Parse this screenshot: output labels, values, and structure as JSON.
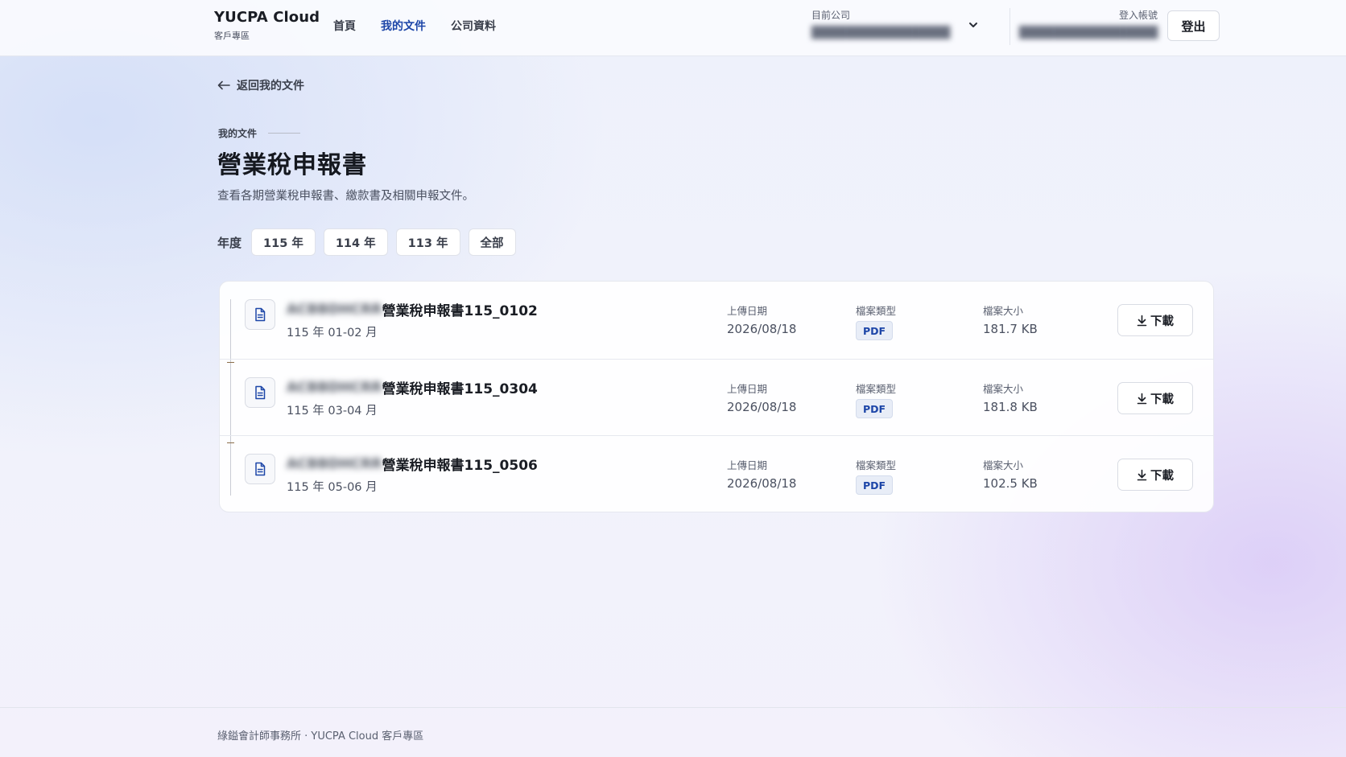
{
  "header": {
    "brand_title": "YUCPA Cloud",
    "brand_subtitle": "客戶專區",
    "nav": [
      {
        "label": "首頁",
        "active": false
      },
      {
        "label": "我的文件",
        "active": true
      },
      {
        "label": "公司資料",
        "active": false
      }
    ],
    "company_label": "目前公司",
    "company_value": "",
    "account_label": "登入帳號",
    "account_value": "",
    "logout_label": "登出"
  },
  "back_link": "返回我的文件",
  "eyebrow": "我的文件",
  "page_title": "營業稅申報書",
  "page_description": "查看各期營業稅申報書、繳款書及相關申報文件。",
  "year_filter": {
    "label": "年度",
    "options": [
      "115 年",
      "114 年",
      "113 年",
      "全部"
    ]
  },
  "documents": [
    {
      "title": "營業稅申報書115_0102",
      "period": "115 年 01-02 月",
      "upload_label": "上傳日期",
      "upload_date": "2026/08/18",
      "type_label": "檔案類型",
      "type": "PDF",
      "size_label": "檔案大小",
      "size": "181.7 KB",
      "download_label": "下載"
    },
    {
      "title": "營業稅申報書115_0304",
      "period": "115 年 03-04 月",
      "upload_label": "上傳日期",
      "upload_date": "2026/08/18",
      "type_label": "檔案類型",
      "type": "PDF",
      "size_label": "檔案大小",
      "size": "181.8 KB",
      "download_label": "下載"
    },
    {
      "title": "營業稅申報書115_0506",
      "period": "115 年 05-06 月",
      "upload_label": "上傳日期",
      "upload_date": "2026/08/18",
      "type_label": "檔案類型",
      "type": "PDF",
      "size_label": "檔案大小",
      "size": "102.5 KB",
      "download_label": "下載"
    }
  ],
  "footer": "綠鎰會計師事務所 · YUCPA Cloud 客戶專區",
  "colors": {
    "accent": "#1d46a8",
    "text": "#1f2430",
    "muted": "#4a5060"
  }
}
